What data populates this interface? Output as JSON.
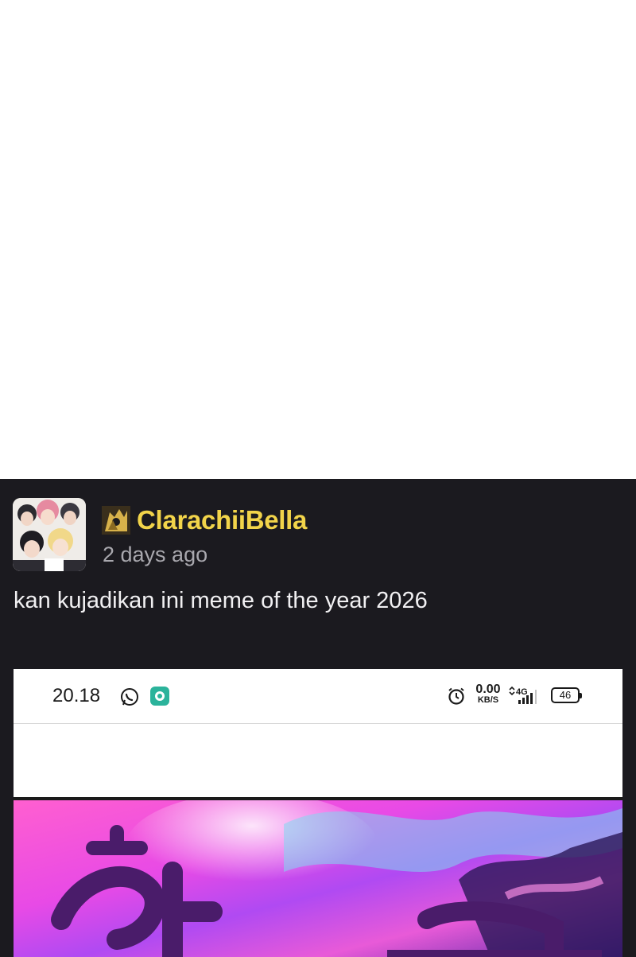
{
  "comment": {
    "username": "ClarachiiBella",
    "time_ago": "2 days ago",
    "text": "kan kujadikan ini meme of the year 2026"
  },
  "embedded_screenshot": {
    "status_bar": {
      "time": "20.18",
      "net_speed_value": "0.00",
      "net_speed_unit": "KB/S",
      "network_type": "4G",
      "battery_level": "46"
    }
  },
  "colors": {
    "panel_background": "#1b1a1f",
    "username_color": "#f2d44a",
    "timestamp_color": "#a9a8ae",
    "text_color": "#f1f0f2"
  },
  "icons": [
    "user-avatar",
    "user-badge-icon",
    "whatsapp-icon",
    "app-notification-icon",
    "alarm-icon",
    "signal-icon",
    "battery-icon"
  ]
}
